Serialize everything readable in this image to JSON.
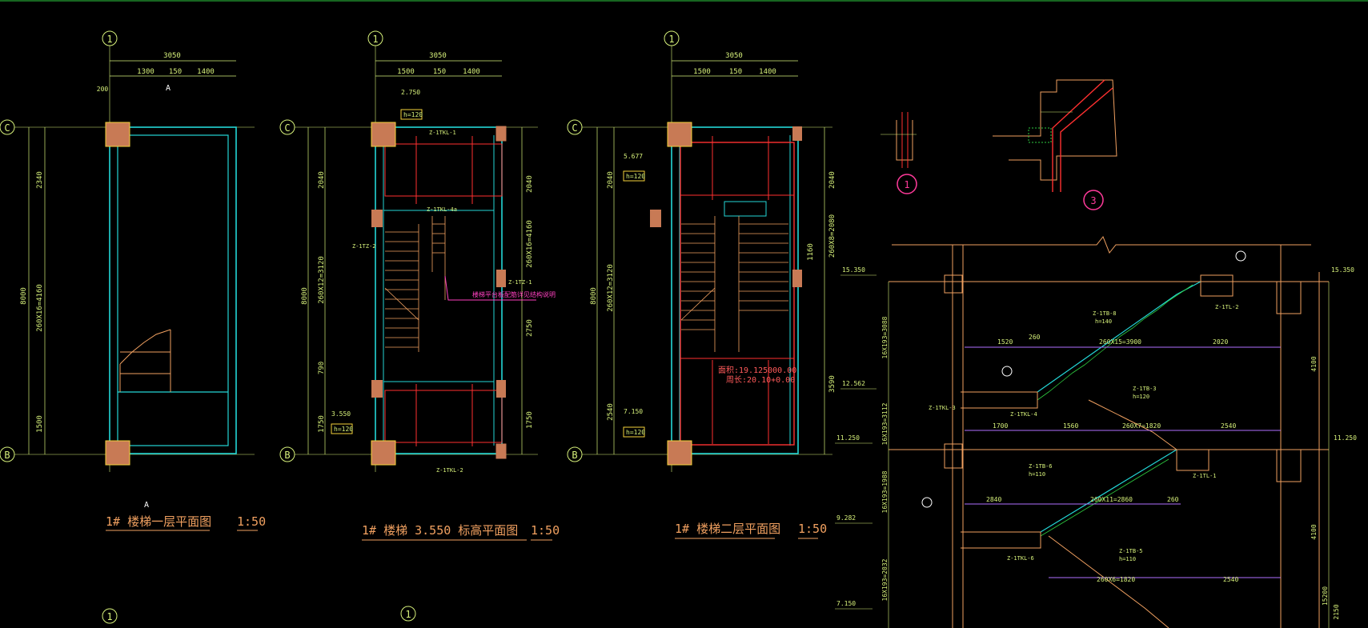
{
  "colors": {
    "background": "#000000",
    "wall_cyan": "#23d6d6",
    "dimension_green": "#d6f07a",
    "rebar_red": "#ff3030",
    "stair_orange": "#f0a060",
    "column_fill": "#c87a55",
    "column_outline": "#f5d23a",
    "level_purple": "#b070ff",
    "callout_magenta": "#ff3a9a",
    "frame_green": "#2ecc40"
  },
  "plans": [
    {
      "title": "1# 楼梯一层平面图",
      "scale": "1:50",
      "grid_top": "1",
      "grid_c": "C",
      "grid_b": "B",
      "dims_top": [
        "3050",
        "1300",
        "150",
        "1400"
      ],
      "dims_left": [
        "2340",
        "8000",
        "260X16=4160",
        "1500"
      ],
      "section_mark": "A",
      "dim_200": "200"
    },
    {
      "title": "1# 楼梯 3.550 标高平面图",
      "scale": "1:50",
      "grid_top": "1",
      "grid_c": "C",
      "grid_b": "B",
      "dims_top": [
        "3050",
        "1500",
        "150",
        "1400"
      ],
      "dims_left": [
        "8000",
        "2040",
        "260X12=3120",
        "790",
        "1750"
      ],
      "dims_right": [
        "2040",
        "260X16=4160",
        "2750",
        "1750"
      ],
      "level_tag": "2.750",
      "h_tag": "h=120",
      "h_tag_2": "h=120",
      "lvl_355": "3.550",
      "beam_labels": [
        "Z-1TKL-1",
        "Z-1TKL-2",
        "Z-1TKL-4a",
        "Z-1TZ-1",
        "Z-1TZ-2"
      ],
      "callout_note": "楼梯平台板配筋详见结构说明"
    },
    {
      "title": "1# 楼梯二层平面图",
      "scale": "1:50",
      "grid_top": "1",
      "grid_c": "C",
      "grid_b": "B",
      "dims_top": [
        "3050",
        "1500",
        "150",
        "1400"
      ],
      "dims_left": [
        "8000",
        "2040",
        "260X12=3120",
        "2540"
      ],
      "dims_right": [
        "2040",
        "260X8=2080",
        "1160",
        "3590"
      ],
      "level_tag": "5.677",
      "level_tag_2": "7.150",
      "h_tag": "h=120",
      "h_tag_2": "h=120",
      "note_line1": "面积:19.125000.00",
      "note_line2": "周长:20.10+0.00"
    }
  ],
  "details": {
    "mark_1": "1",
    "mark_3": "3"
  },
  "section": {
    "levels": [
      "15.350",
      "12.562",
      "11.250",
      "9.282",
      "7.150"
    ],
    "right_levels": [
      "15.350",
      "11.250"
    ],
    "runs": [
      {
        "label": "Z-1TB-8",
        "h": "h=140",
        "dim": "260X15=3900",
        "left": "1520",
        "mid": "260",
        "right": "2020"
      },
      {
        "label": "Z-1TB-3",
        "h": "h=120",
        "dim": "260X7=1820",
        "left": "1700",
        "mid": "1560",
        "right": "2540"
      },
      {
        "label": "Z-1TB-6",
        "h": "h=110",
        "dim": "260X11=2860",
        "left": "2840",
        "mid": "260"
      },
      {
        "label": "Z-1TB-5",
        "h": "h=110",
        "dim": "260X6=1820",
        "right": "2540"
      }
    ],
    "side_dims": [
      "16X193=3088",
      "16X193=3112",
      "16X193=1988",
      "16X193=2032"
    ],
    "right_dims": [
      "4100",
      "4100",
      "15200",
      "2150"
    ],
    "labels": [
      "Z-1TL-2",
      "Z-1TL-1",
      "Z-1TKL-3",
      "Z-1TKL-4",
      "Z-1TKL-6"
    ]
  },
  "bottom_grids": [
    "1",
    "1"
  ]
}
